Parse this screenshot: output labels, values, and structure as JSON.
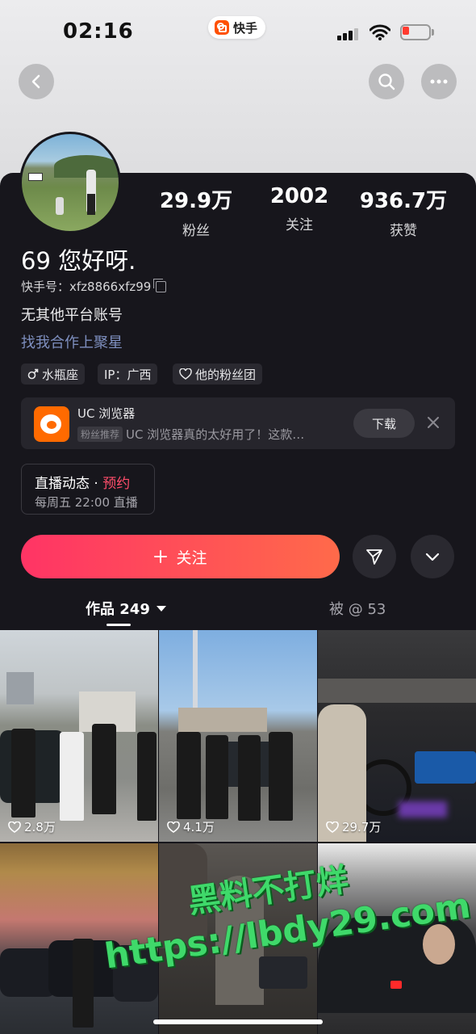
{
  "status_bar": {
    "time": "02:16",
    "app_name": "快手",
    "battery_color": "#ff3b30"
  },
  "header": {
    "back_icon": "chevron-left-icon",
    "search_icon": "search-icon",
    "more_icon": "more-horizontal-icon"
  },
  "profile": {
    "stats": [
      {
        "value": "29.9万",
        "label": "粉丝"
      },
      {
        "value": "2002",
        "label": "关注"
      },
      {
        "value": "936.7万",
        "label": "获赞"
      }
    ],
    "name": "69 您好呀.",
    "kwai_id": "快手号：xfz8866xfz99",
    "bio": "无其他平台账号",
    "coop_link": "找我合作上聚星",
    "tags": [
      "水瓶座",
      "IP：广西",
      "他的粉丝团"
    ]
  },
  "ad": {
    "title": "UC 浏览器",
    "badge": "粉丝推荐",
    "text": "UC 浏览器真的太好用了！这款…",
    "download_label": "下载"
  },
  "live": {
    "title": "直播动态 · ",
    "reserve": "预约",
    "time": "每周五 22:00 直播"
  },
  "actions": {
    "follow_label": "关注",
    "accent": "#ff3465"
  },
  "tabs": {
    "works": "作品 249",
    "mentions": "被 @ 53"
  },
  "videos": [
    {
      "likes": "2.8万"
    },
    {
      "likes": "4.1万"
    },
    {
      "likes": "29.7万"
    }
  ],
  "watermark": {
    "cn": "黑料不打烊",
    "url": "https://lbdy29.com"
  }
}
